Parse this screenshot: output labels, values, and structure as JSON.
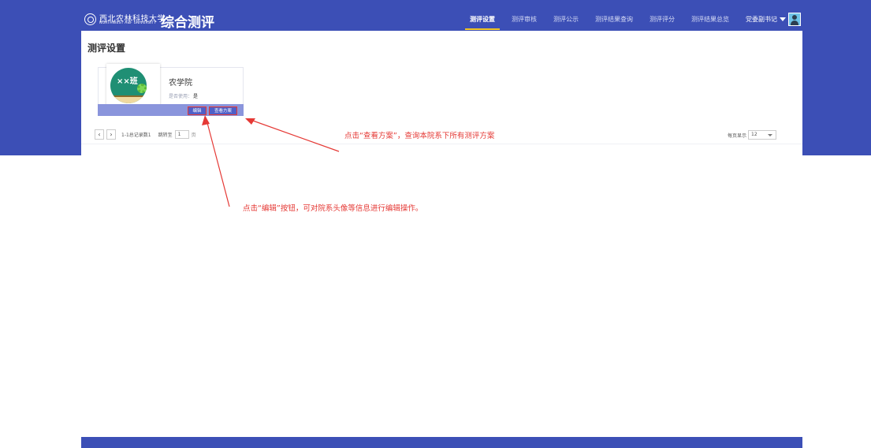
{
  "header": {
    "logo_cn": "西北农林科技大学",
    "logo_en": "NORTHWEST A&F UNIVERSITY",
    "app_title": "综合测评",
    "nav": [
      {
        "label": "测评设置",
        "active": true
      },
      {
        "label": "测评审核",
        "active": false
      },
      {
        "label": "测评公示",
        "active": false
      },
      {
        "label": "测评结果查询",
        "active": false
      },
      {
        "label": "测评评分",
        "active": false
      },
      {
        "label": "测评结果总览",
        "active": false
      }
    ],
    "user_name": "党委副书记",
    "accent_color": "#3c4fb6",
    "active_underline_color": "#f3c623"
  },
  "page": {
    "title": "测评设置"
  },
  "card": {
    "image_text": "××班",
    "name": "农学院",
    "status_label": "是否使用：",
    "status_value": "是",
    "edit_button": "编辑",
    "view_button": "查看方案"
  },
  "pagination": {
    "prev_icon": "‹",
    "next_icon": "›",
    "info": "1-1总记录数1",
    "jump_label": "跳转至",
    "jump_value": "1",
    "page_unit": "页",
    "per_page_label": "每页显示",
    "per_page_value": "12"
  },
  "annotations": {
    "view_hint": "点击“查看方案”，查询本院系下所有测评方案",
    "edit_hint": "点击“编辑”按钮，可对院系头像等信息进行编辑操作。",
    "color": "#e53935"
  }
}
